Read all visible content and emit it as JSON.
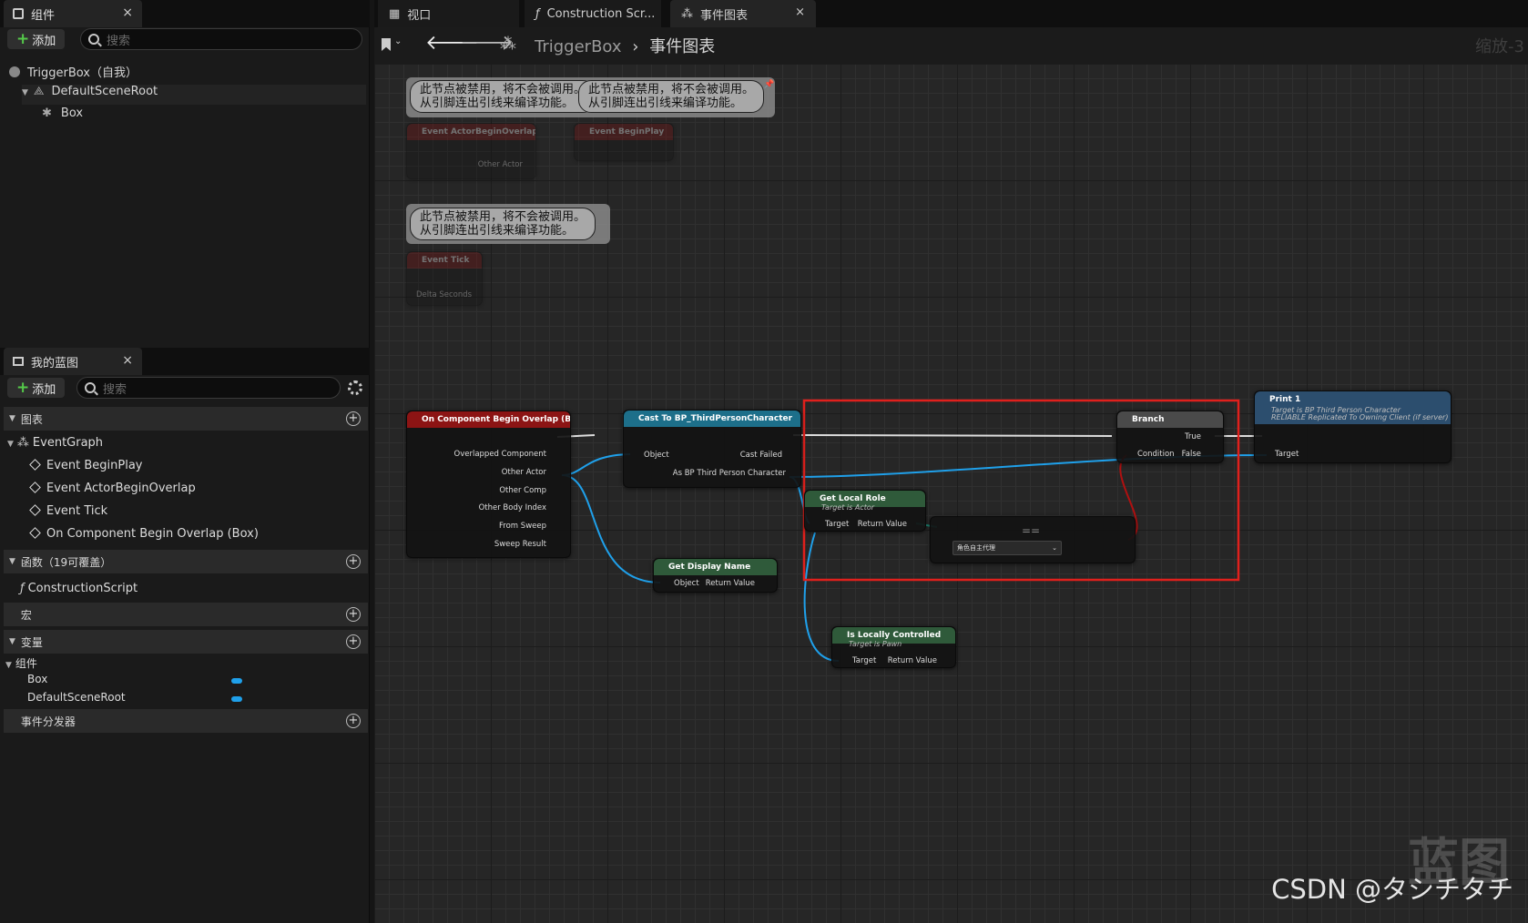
{
  "components_panel": {
    "tab_label": "组件",
    "add_label": "添加",
    "search_placeholder": "搜索",
    "tree": [
      {
        "label": "TriggerBox（自我）"
      },
      {
        "label": "DefaultSceneRoot"
      },
      {
        "label": "Box"
      }
    ]
  },
  "blueprint_panel": {
    "tab_label": "我的蓝图",
    "add_label": "添加",
    "search_placeholder": "搜索",
    "sections": {
      "graphs": "图表",
      "functions": "函数（19可覆盖）",
      "macros": "宏",
      "variables": "变量",
      "dispatchers": "事件分发器"
    },
    "event_graph": "EventGraph",
    "events": [
      "Event BeginPlay",
      "Event ActorBeginOverlap",
      "Event Tick",
      "On Component Begin Overlap (Box)"
    ],
    "function_item": "ConstructionScript",
    "var_group": "组件",
    "variables": [
      "Box",
      "DefaultSceneRoot"
    ]
  },
  "editor_tabs": [
    "视口",
    "Construction Scr...",
    "事件图表"
  ],
  "breadcrumb": {
    "root": "TriggerBox",
    "current": "事件图表"
  },
  "zoom_label": "缩放-3",
  "comments": {
    "disabled_text_1": "此节点被禁用，将不会被调用。",
    "disabled_text_2": "从引脚连出引线来编译功能。"
  },
  "nodes": {
    "actor_overlap": {
      "title": "Event ActorBeginOverlap",
      "pin": "Other Actor"
    },
    "begin_play": {
      "title": "Event BeginPlay"
    },
    "tick": {
      "title": "Event Tick",
      "pin": "Delta Seconds"
    },
    "comp_overlap": {
      "title": "On Component Begin Overlap (Box)",
      "pins": [
        "Overlapped Component",
        "Other Actor",
        "Other Comp",
        "Other Body Index",
        "From Sweep",
        "Sweep Result"
      ]
    },
    "cast": {
      "title": "Cast To BP_ThirdPersonCharacter",
      "in": "Object",
      "fail": "Cast Failed",
      "out": "As BP Third Person Character"
    },
    "display_name": {
      "title": "Get Display Name",
      "in": "Object",
      "out": "Return Value"
    },
    "local_role": {
      "title": "Get Local Role",
      "sub": "Target is Actor",
      "in": "Target",
      "out": "Return Value"
    },
    "equal": {
      "symbol": "==",
      "dropdown": "角色自主代理"
    },
    "locally_controlled": {
      "title": "Is Locally Controlled",
      "sub": "Target is Pawn",
      "in": "Target",
      "out": "Return Value"
    },
    "branch": {
      "title": "Branch",
      "cond": "Condition",
      "true": "True",
      "false": "False"
    },
    "print": {
      "title": "Print 1",
      "sub1": "Target is BP Third Person Character",
      "sub2": "RELIABLE Replicated To Owning Client (if server)",
      "in": "Target"
    }
  },
  "watermark": "CSDN @タシチタチ",
  "watermark_logo": "蓝图"
}
